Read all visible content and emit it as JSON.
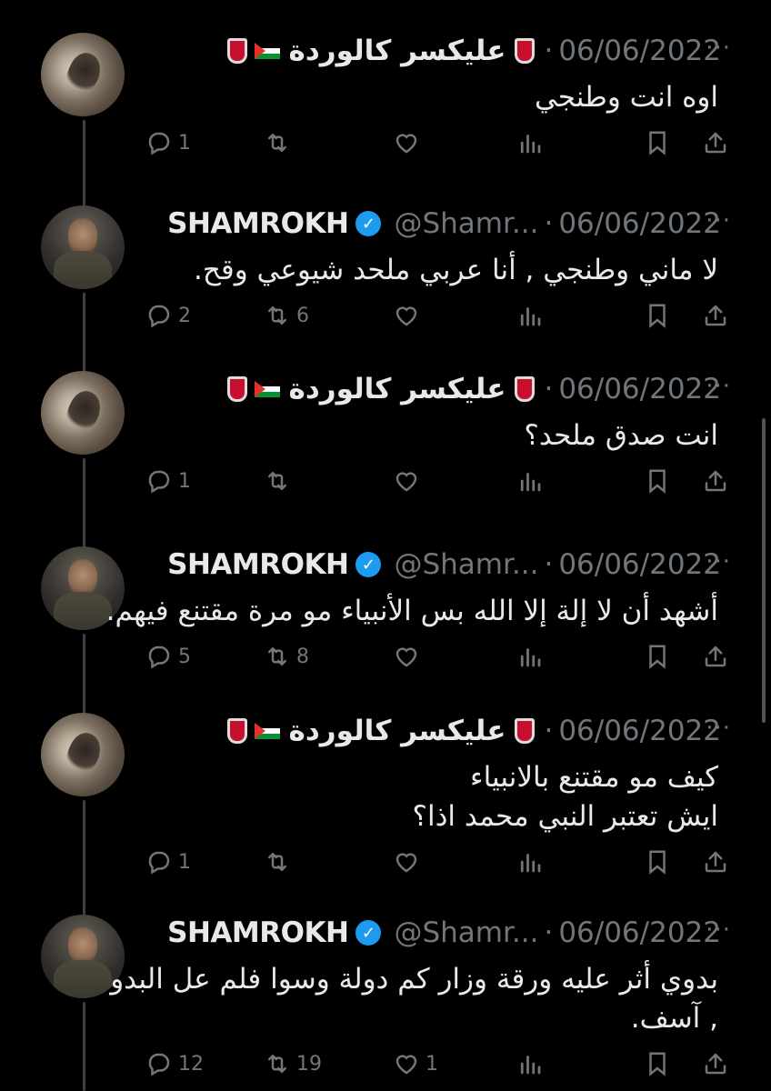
{
  "tweets": [
    {
      "author_ar": "عليكسر كالوردة",
      "has_flag": true,
      "handle": "",
      "date": "06/06/2022",
      "body": "اوه انت وطنجي",
      "replies": "1",
      "retweets": "",
      "likes": "",
      "avatar": "cat"
    },
    {
      "author_en": "SHAMROKH",
      "verified": true,
      "handle": "@Shamr...",
      "date": "06/06/2022",
      "body": "لا ماني وطنجي , أنا عربي ملحد شيوعي وقح.",
      "replies": "2",
      "retweets": "6",
      "likes": "",
      "avatar": "man"
    },
    {
      "author_ar": "عليكسر كالوردة",
      "has_flag": true,
      "handle": "",
      "date": "06/06/2022",
      "body": "انت صدق ملحد؟",
      "replies": "1",
      "retweets": "",
      "likes": "",
      "avatar": "cat"
    },
    {
      "author_en": "SHAMROKH",
      "verified": true,
      "handle": "@Shamr...",
      "date": "06/06/2022",
      "body": "أشهد أن لا إلة إلا الله بس الأنبياء مو مرة مقتنع فيهم.",
      "replies": "5",
      "retweets": "8",
      "likes": "",
      "avatar": "man"
    },
    {
      "author_ar": "عليكسر كالوردة",
      "has_flag": true,
      "handle": "",
      "date": "06/06/2022",
      "body": "كيف مو مقتنع بالانبياء\nايش تعتبر النبي محمد اذا؟",
      "replies": "1",
      "retweets": "",
      "likes": "",
      "avatar": "cat"
    },
    {
      "author_en": "SHAMROKH",
      "verified": true,
      "handle": "@Shamr...",
      "date": "06/06/2022",
      "body": "بدوي أثر عليه ورقة وزار كم دولة وسوا فلم عل البدو\n, آسف.",
      "replies": "12",
      "retweets": "19",
      "likes": "1",
      "avatar": "man"
    }
  ],
  "ui": {
    "separator": "·",
    "more": "···"
  },
  "icons": [
    "reply-icon",
    "retweet-icon",
    "like-icon",
    "views-icon",
    "bookmark-icon",
    "share-icon",
    "verified-icon",
    "club-badge-icon",
    "palestine-flag-icon"
  ],
  "colors": {
    "background": "#000000",
    "text": "#e7e9ea",
    "muted": "#71767b",
    "verified": "#1d9bf0"
  }
}
